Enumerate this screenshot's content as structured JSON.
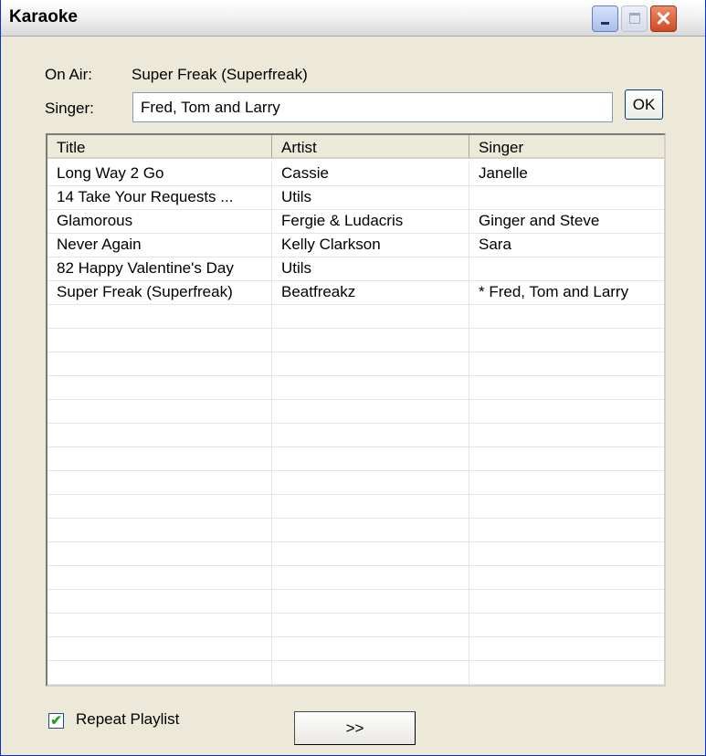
{
  "window": {
    "title": "Karaoke"
  },
  "on_air": {
    "label": "On Air:",
    "value": "Super Freak (Superfreak)"
  },
  "singer": {
    "label": "Singer:",
    "value": "Fred, Tom and Larry",
    "ok_label": "OK"
  },
  "playlist": {
    "columns": [
      "Title",
      "Artist",
      "Singer"
    ],
    "rows": [
      {
        "title": "Long Way 2 Go",
        "artist": "Cassie",
        "singer": "Janelle"
      },
      {
        "title": "14 Take Your Requests ...",
        "artist": "Utils",
        "singer": ""
      },
      {
        "title": "Glamorous",
        "artist": "Fergie & Ludacris",
        "singer": "Ginger and Steve"
      },
      {
        "title": "Never Again",
        "artist": "Kelly Clarkson",
        "singer": "Sara"
      },
      {
        "title": "82 Happy Valentine's Day",
        "artist": "Utils",
        "singer": ""
      },
      {
        "title": "Super Freak (Superfreak)",
        "artist": "Beatfreakz",
        "singer": "* Fred, Tom and Larry"
      }
    ]
  },
  "controls": {
    "repeat_label": "Repeat Playlist",
    "repeat_checked": true,
    "next_label": ">>"
  },
  "icons": {
    "minimize": "minimize-icon",
    "maximize": "maximize-icon",
    "close": "close-icon",
    "check": "checkmark-icon"
  },
  "colors": {
    "title_border": "#0831d9",
    "close_button": "#d04a22",
    "face": "#ece9d8"
  }
}
